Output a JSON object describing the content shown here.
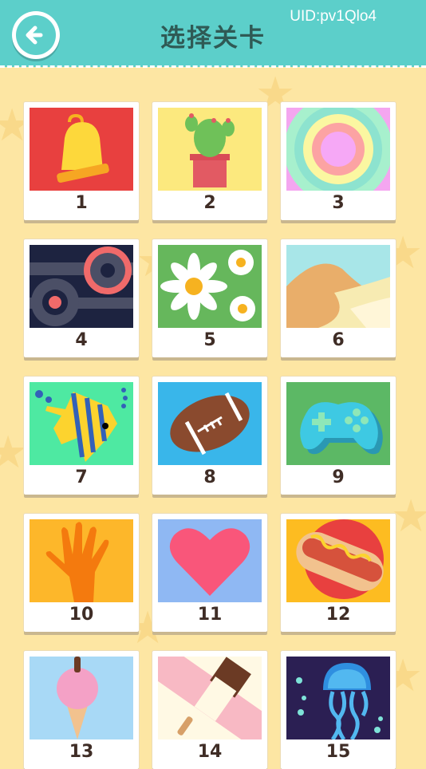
{
  "header": {
    "title": "选择关卡",
    "uid": "UID:pv1Qlo4"
  },
  "levels": [
    {
      "label": "1",
      "icon": "bell-icon",
      "bg": "#e8403f"
    },
    {
      "label": "2",
      "icon": "cactus-icon",
      "bg": "#fce97e"
    },
    {
      "label": "3",
      "icon": "rings-icon",
      "bg": "#f4a6f0"
    },
    {
      "label": "4",
      "icon": "gears-icon",
      "bg": "#1d2340"
    },
    {
      "label": "5",
      "icon": "daisy-icon",
      "bg": "#66b75c"
    },
    {
      "label": "6",
      "icon": "desert-icon",
      "bg": "#f7ebb2"
    },
    {
      "label": "7",
      "icon": "fish-icon",
      "bg": "#4ee9a2"
    },
    {
      "label": "8",
      "icon": "football-icon",
      "bg": "#39b6ea"
    },
    {
      "label": "9",
      "icon": "gamepad-icon",
      "bg": "#5cb865"
    },
    {
      "label": "10",
      "icon": "hand-icon",
      "bg": "#fdb72a"
    },
    {
      "label": "11",
      "icon": "heart-icon",
      "bg": "#8fb8f3"
    },
    {
      "label": "12",
      "icon": "hotdog-icon",
      "bg": "#fdbc21"
    },
    {
      "label": "13",
      "icon": "icecream-icon",
      "bg": "#a8d9f6"
    },
    {
      "label": "14",
      "icon": "popsicle-icon",
      "bg": "#fff9e4"
    },
    {
      "label": "15",
      "icon": "jellyfish-icon",
      "bg": "#2b1f53"
    }
  ]
}
